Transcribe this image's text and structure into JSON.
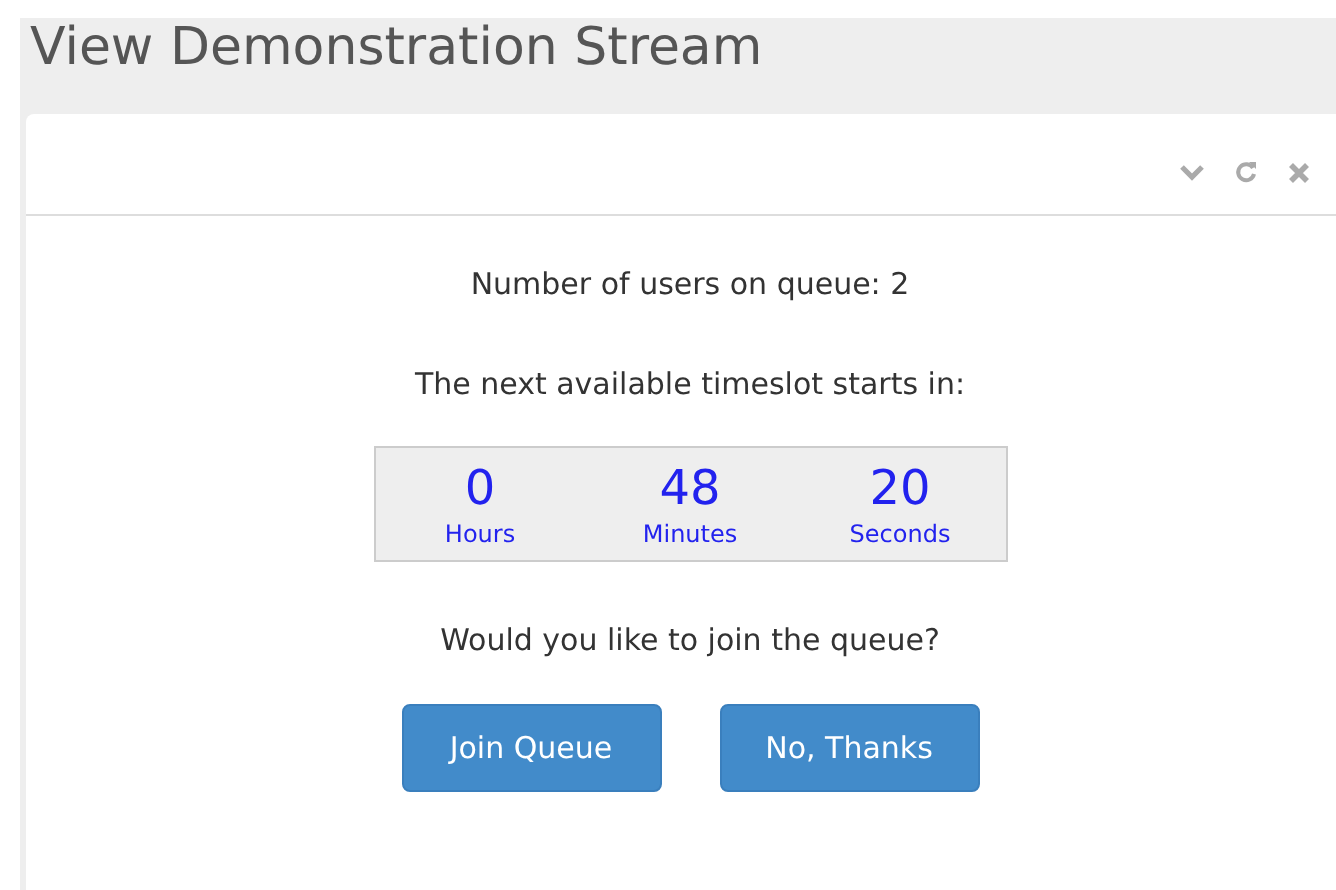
{
  "page_title": "View Demonstration Stream",
  "queue_text": "Number of users on queue: 2",
  "timeslot_text": "The next available timeslot starts in:",
  "countdown": [
    {
      "value": "0",
      "unit": "Hours"
    },
    {
      "value": "48",
      "unit": "Minutes"
    },
    {
      "value": "20",
      "unit": "Seconds"
    }
  ],
  "question": "Would you like to join the queue?",
  "buttons": [
    "Join Queue",
    "No, Thanks"
  ]
}
